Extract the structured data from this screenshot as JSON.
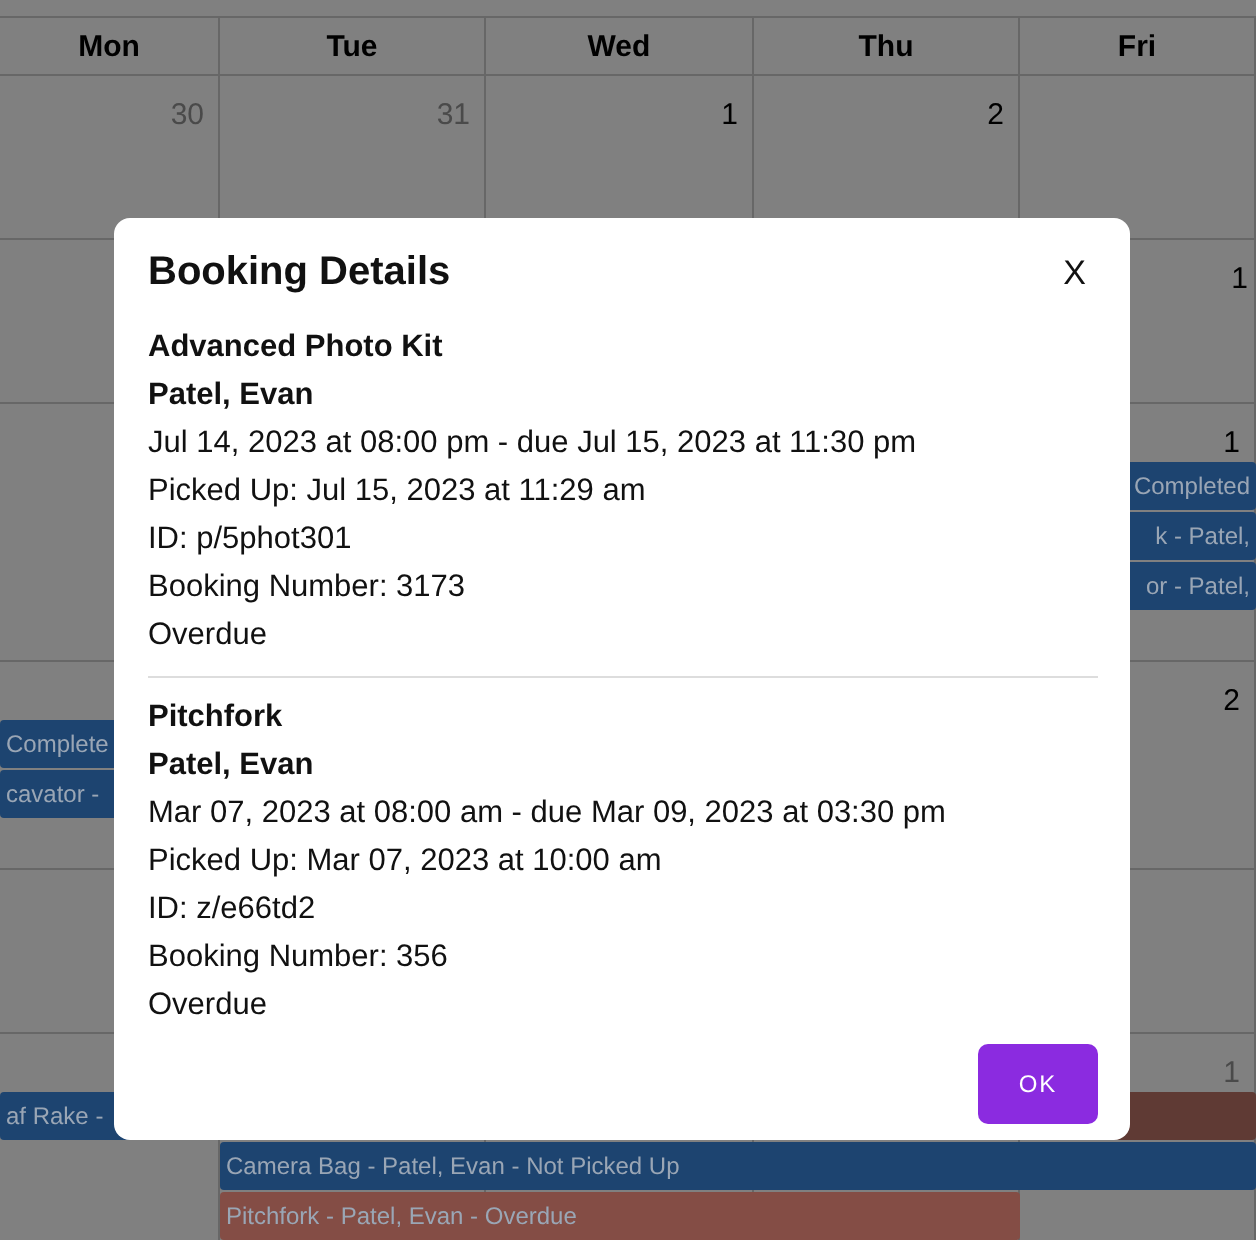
{
  "calendar": {
    "weekdays": [
      "Mon",
      "Tue",
      "Wed",
      "Thu",
      "Fri"
    ],
    "weeks": [
      {
        "dates": {
          "mon": {
            "number": "30",
            "other_month": true
          },
          "tue": {
            "number": "31",
            "other_month": true
          },
          "wed": {
            "number": "1",
            "other_month": false
          },
          "thu": {
            "number": "2",
            "other_month": false
          }
        }
      },
      {
        "dates": {
          "fri": {
            "number": "1",
            "other_month": false
          }
        }
      },
      {
        "dates": {
          "fri": {
            "number": "1",
            "other_month": false
          }
        },
        "events": [
          {
            "text": "Completed",
            "color": "#1d4470"
          },
          {
            "text": "k - Patel,",
            "color": "#1d4470"
          },
          {
            "text": "or - Patel,",
            "color": "#1d4470"
          }
        ]
      },
      {
        "dates": {
          "fri": {
            "number": "2",
            "other_month": false
          }
        },
        "events": [
          {
            "text": "Complete",
            "color": "#1d4470"
          },
          {
            "text": "cavator -",
            "color": "#1d4470"
          }
        ]
      },
      {
        "dates": {
          "fri": {
            "number": "1",
            "other_month": true
          }
        },
        "events": [
          {
            "text": "af Rake -",
            "color": "#1d4470"
          },
          {
            "color": "#5f3a34"
          },
          {
            "text": "Camera Bag - Patel, Evan - Not Picked Up",
            "color": "#1d4470"
          },
          {
            "text": "Pitchfork - Patel, Evan - Overdue",
            "color": "#844d45"
          }
        ]
      }
    ]
  },
  "dialog": {
    "title": "Booking Details",
    "close": "X",
    "bookings": [
      {
        "item": "Advanced Photo Kit",
        "customer": "Patel, Evan",
        "period": "Jul 14, 2023 at 08:00 pm - due Jul 15, 2023 at 11:30 pm",
        "picked_up": "Picked Up: Jul 15, 2023 at 11:29 am",
        "id": "ID: p/5phot301",
        "booking_number": "Booking Number: 3173",
        "status": "Overdue"
      },
      {
        "item": "Pitchfork",
        "customer": "Patel, Evan",
        "period": "Mar 07, 2023 at 08:00 am - due Mar 09, 2023 at 03:30 pm",
        "picked_up": "Picked Up: Mar 07, 2023 at 10:00 am",
        "id": "ID: z/e66td2",
        "booking_number": "Booking Number: 356",
        "status": "Overdue"
      }
    ],
    "ok": "OK"
  }
}
